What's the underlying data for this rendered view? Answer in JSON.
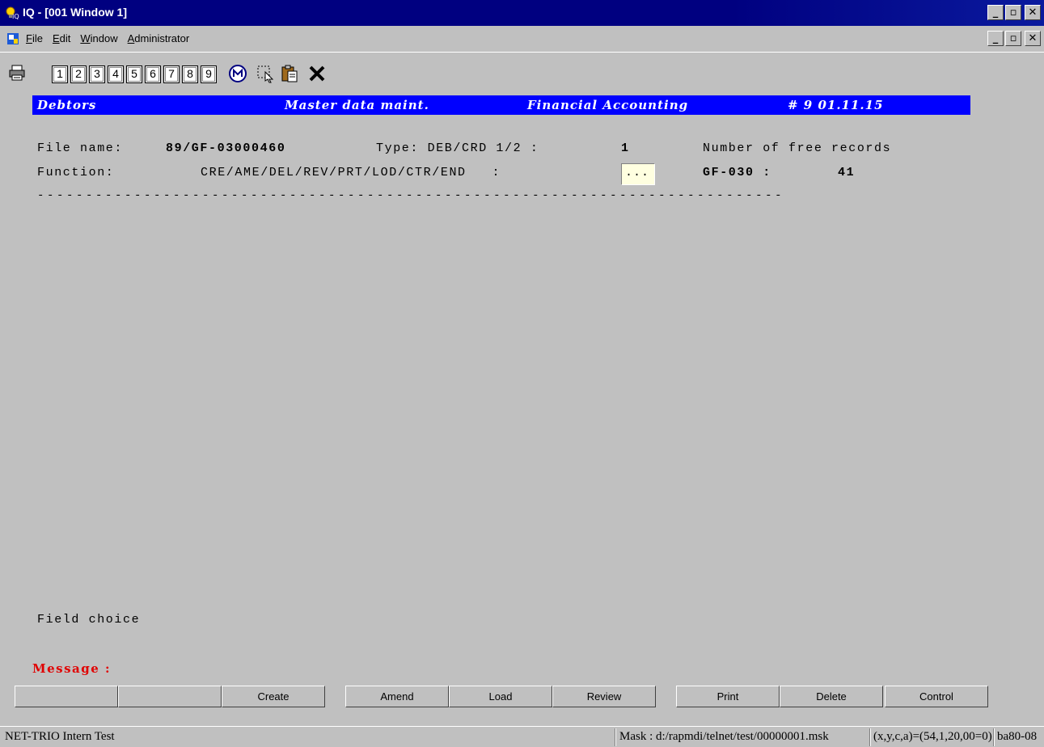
{
  "window": {
    "title": "IQ - [001  Window 1]"
  },
  "menu": {
    "items": [
      "File",
      "Edit",
      "Window",
      "Administrator"
    ]
  },
  "toolbar": {
    "number_buttons": [
      "1",
      "2",
      "3",
      "4",
      "5",
      "6",
      "7",
      "8",
      "9"
    ]
  },
  "screen": {
    "banner": {
      "module": "Debtors",
      "function": "Master data maint.",
      "system": "Financial Accounting",
      "id_date": "# 9 01.11.15"
    },
    "file_name_label": "File name:",
    "file_name_value": "89/GF-03000460",
    "type_label": "Type: DEB/CRD 1/2 :",
    "type_value": "1",
    "free_records_label": "Number of free records",
    "function_label": "Function:",
    "function_options": "CRE/AME/DEL/REV/PRT/LOD/CTR/END   :",
    "function_input": "...",
    "free_records_key": "GF-030 :",
    "free_records_value": "41",
    "separator": "-----------------------------------------------------------------------------",
    "field_choice": "Field choice",
    "message_label": "Message :"
  },
  "function_keys": [
    "",
    "",
    "Create",
    "Amend",
    "Load",
    "Review",
    "Print",
    "Delete",
    "Control"
  ],
  "status": {
    "left": "NET-TRIO Intern Test",
    "mask": "Mask : d:/rapmdi/telnet/test/00000001.msk",
    "coords": "(x,y,c,a)=(54,1,20,00=0)",
    "code": "ba80-08"
  }
}
